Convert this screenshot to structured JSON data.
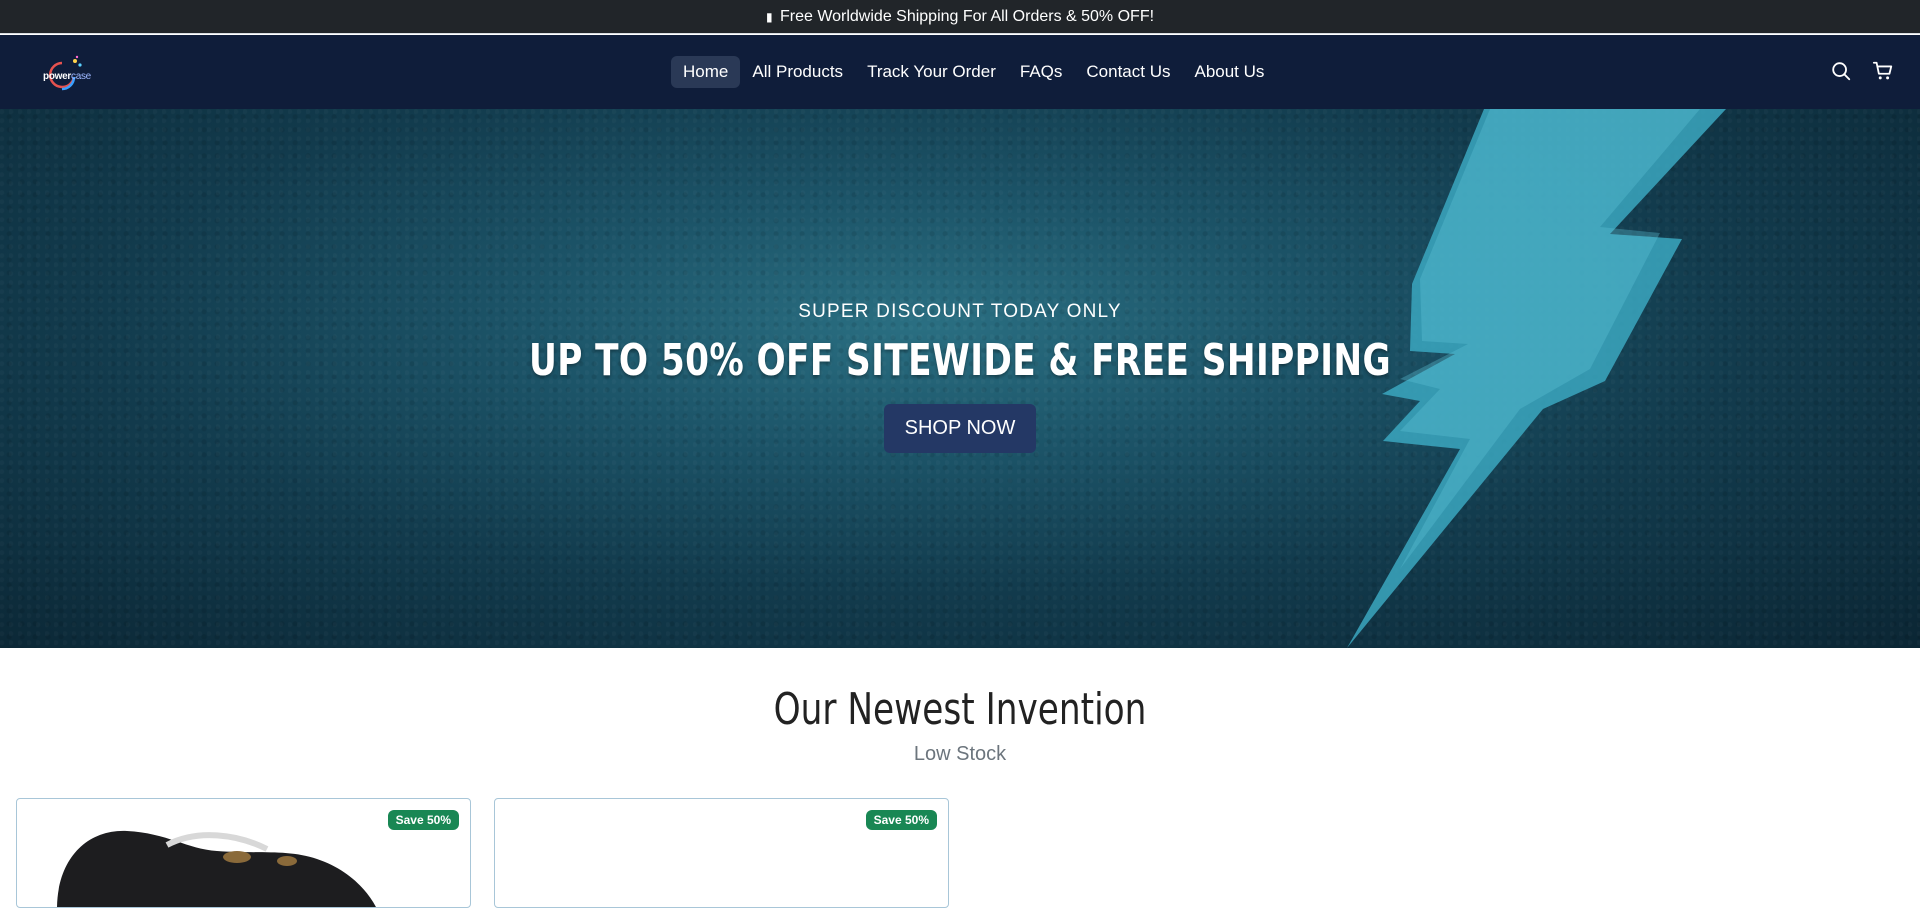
{
  "announcement": {
    "text": "Free Worldwide Shipping For All Orders & 50% OFF!",
    "icon": "bolt-icon"
  },
  "header": {
    "logo_brand": "power",
    "logo_brand_suffix": "case",
    "nav": [
      {
        "label": "Home",
        "active": true
      },
      {
        "label": "All Products"
      },
      {
        "label": "Track Your Order"
      },
      {
        "label": "FAQs"
      },
      {
        "label": "Contact Us"
      },
      {
        "label": "About Us"
      }
    ],
    "icons": [
      "search-icon",
      "cart-icon"
    ]
  },
  "hero": {
    "kicker": "SUPER DISCOUNT TODAY ONLY",
    "title": "UP TO 50% OFF SITEWIDE & FREE SHIPPING",
    "button": "SHOP NOW"
  },
  "section": {
    "title": "Our Newest Invention",
    "subtitle": "Low Stock"
  },
  "products": [
    {
      "badge": "Save 50%"
    },
    {
      "badge": "Save 50%"
    }
  ],
  "colors": {
    "announcement_bg": "#212529",
    "navbar_bg": "#0f1d3a",
    "button_bg": "#243865",
    "badge_bg": "#198754"
  }
}
